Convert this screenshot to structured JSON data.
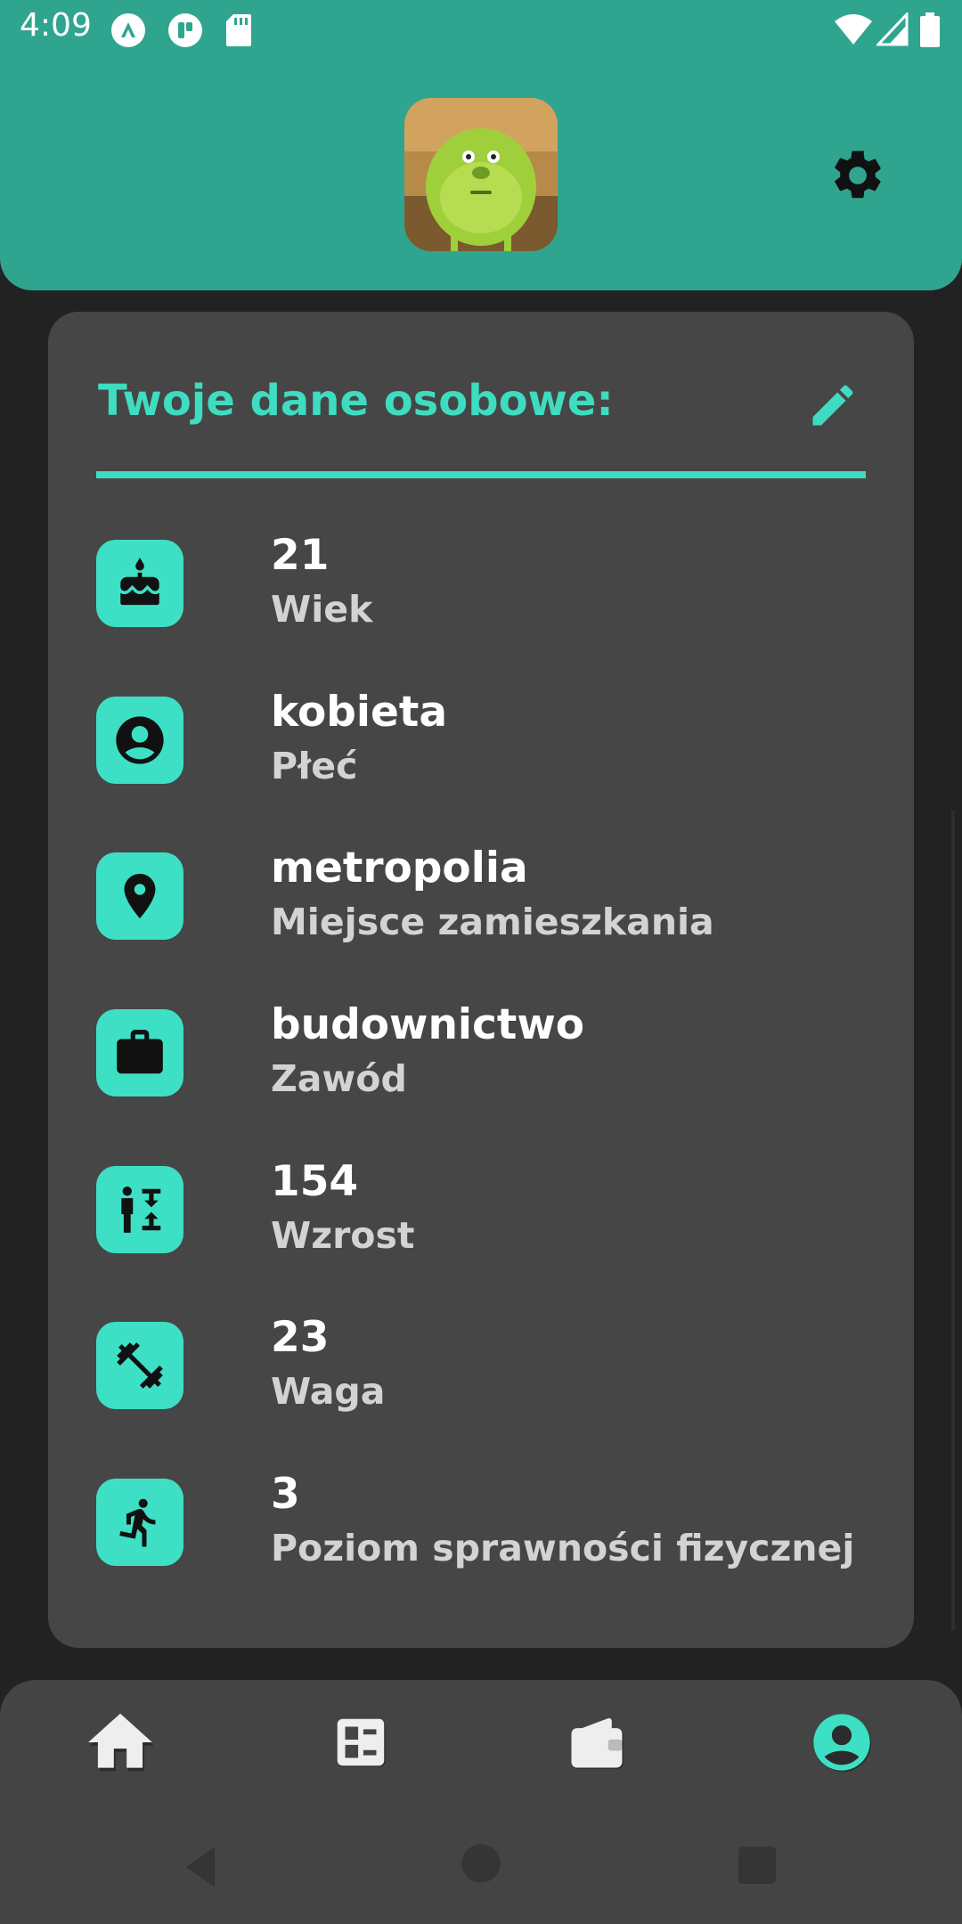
{
  "status_bar": {
    "time": "4:09",
    "icons": [
      "app-notification-icon",
      "app-notification-icon-2",
      "sd-card-icon",
      "wifi-icon",
      "signal-icon",
      "battery-icon"
    ]
  },
  "header": {
    "avatar": "profile-avatar-image",
    "settings_icon": "gear-icon"
  },
  "personal_data": {
    "title": "Twoje dane osobowe:",
    "edit_icon": "pencil-icon",
    "items": [
      {
        "value": "21",
        "label": "Wiek",
        "icon": "cake-icon"
      },
      {
        "value": "kobieta",
        "label": "Płeć",
        "icon": "person-circle-icon"
      },
      {
        "value": "metropolia",
        "label": "Miejsce zamieszkania",
        "icon": "location-pin-icon"
      },
      {
        "value": "budownictwo",
        "label": "Zawód",
        "icon": "briefcase-icon"
      },
      {
        "value": "154",
        "label": "Wzrost",
        "icon": "height-icon"
      },
      {
        "value": "23",
        "label": "Waga",
        "icon": "dumbbell-icon"
      },
      {
        "value": "3",
        "label": "Poziom sprawności fizycznej",
        "icon": "running-icon"
      }
    ]
  },
  "bottom_nav": {
    "items": [
      "home-icon",
      "dashboard-icon",
      "wallet-icon",
      "account-icon"
    ],
    "active_index": 3
  },
  "colors": {
    "header_bg": "#2fa58f",
    "accent": "#3edcc0",
    "card_bg": "#464646",
    "page_bg": "#222222"
  }
}
